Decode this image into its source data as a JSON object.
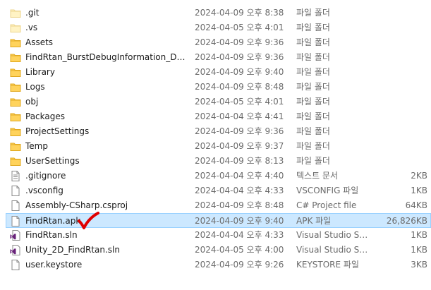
{
  "files": [
    {
      "name": ".git",
      "date": "2024-04-09 오후 8:38",
      "type": "파일 폴더",
      "size": "",
      "icon": "folder-hidden-icon"
    },
    {
      "name": ".vs",
      "date": "2024-04-05 오후 4:01",
      "type": "파일 폴더",
      "size": "",
      "icon": "folder-hidden-icon"
    },
    {
      "name": "Assets",
      "date": "2024-04-09 오후 9:36",
      "type": "파일 폴더",
      "size": "",
      "icon": "folder-icon"
    },
    {
      "name": "FindRtan_BurstDebugInformation_DoNo...",
      "date": "2024-04-09 오후 9:36",
      "type": "파일 폴더",
      "size": "",
      "icon": "folder-icon"
    },
    {
      "name": "Library",
      "date": "2024-04-09 오후 9:40",
      "type": "파일 폴더",
      "size": "",
      "icon": "folder-icon"
    },
    {
      "name": "Logs",
      "date": "2024-04-09 오후 8:48",
      "type": "파일 폴더",
      "size": "",
      "icon": "folder-icon"
    },
    {
      "name": "obj",
      "date": "2024-04-05 오후 4:01",
      "type": "파일 폴더",
      "size": "",
      "icon": "folder-icon"
    },
    {
      "name": "Packages",
      "date": "2024-04-04 오후 4:41",
      "type": "파일 폴더",
      "size": "",
      "icon": "folder-icon"
    },
    {
      "name": "ProjectSettings",
      "date": "2024-04-09 오후 9:36",
      "type": "파일 폴더",
      "size": "",
      "icon": "folder-icon"
    },
    {
      "name": "Temp",
      "date": "2024-04-09 오후 9:37",
      "type": "파일 폴더",
      "size": "",
      "icon": "folder-icon"
    },
    {
      "name": "UserSettings",
      "date": "2024-04-09 오후 8:13",
      "type": "파일 폴더",
      "size": "",
      "icon": "folder-icon"
    },
    {
      "name": ".gitignore",
      "date": "2024-04-04 오후 4:40",
      "type": "텍스트 문서",
      "size": "2KB",
      "icon": "text-file-icon"
    },
    {
      "name": ".vsconfig",
      "date": "2024-04-04 오후 4:33",
      "type": "VSCONFIG 파일",
      "size": "1KB",
      "icon": "file-icon"
    },
    {
      "name": "Assembly-CSharp.csproj",
      "date": "2024-04-09 오후 8:48",
      "type": "C# Project file",
      "size": "64KB",
      "icon": "file-icon"
    },
    {
      "name": "FindRtan.apk",
      "date": "2024-04-09 오후 9:40",
      "type": "APK 파일",
      "size": "26,826KB",
      "icon": "file-icon",
      "selected": true
    },
    {
      "name": "FindRtan.sln",
      "date": "2024-04-04 오후 4:33",
      "type": "Visual Studio Sol...",
      "size": "1KB",
      "icon": "visual-studio-solution-icon"
    },
    {
      "name": "Unity_2D_FindRtan.sln",
      "date": "2024-04-05 오후 4:00",
      "type": "Visual Studio Sol...",
      "size": "1KB",
      "icon": "visual-studio-solution-icon"
    },
    {
      "name": "user.keystore",
      "date": "2024-04-09 오후 9:26",
      "type": "KEYSTORE 파일",
      "size": "3KB",
      "icon": "file-icon"
    }
  ],
  "colors": {
    "selection_bg": "#cce8ff",
    "selection_border": "#99d1ff",
    "annotation_check": "#e00000",
    "folder": "#ffd35c"
  },
  "annotation": {
    "icon": "red-checkmark-annotation"
  }
}
